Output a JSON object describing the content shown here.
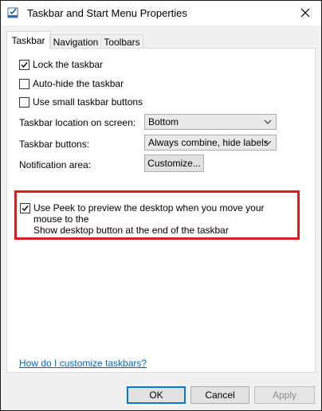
{
  "window": {
    "title": "Taskbar and Start Menu Properties",
    "icon": "taskbar-properties-icon"
  },
  "tabs": [
    {
      "label": "Taskbar",
      "active": true
    },
    {
      "label": "Navigation",
      "active": false
    },
    {
      "label": "Toolbars",
      "active": false
    }
  ],
  "options": {
    "lock_taskbar": {
      "label": "Lock the taskbar",
      "checked": true
    },
    "auto_hide": {
      "label": "Auto-hide the taskbar",
      "checked": false
    },
    "small_buttons": {
      "label": "Use small taskbar buttons",
      "checked": false
    }
  },
  "fields": {
    "location": {
      "label": "Taskbar location on screen:",
      "value": "Bottom"
    },
    "buttons": {
      "label": "Taskbar buttons:",
      "value": "Always combine, hide labels"
    },
    "notification": {
      "label": "Notification area:",
      "button": "Customize..."
    }
  },
  "peek": {
    "line1": "Use Peek to preview the desktop when you move your mouse to the",
    "line2": "Show desktop button at the end of the taskbar",
    "checked": true
  },
  "help_link": "How do I customize taskbars?",
  "footer": {
    "ok": "OK",
    "cancel": "Cancel",
    "apply": "Apply"
  },
  "colors": {
    "highlight": "#d71e1e",
    "link": "#0066cc",
    "focus": "#0078d7"
  }
}
